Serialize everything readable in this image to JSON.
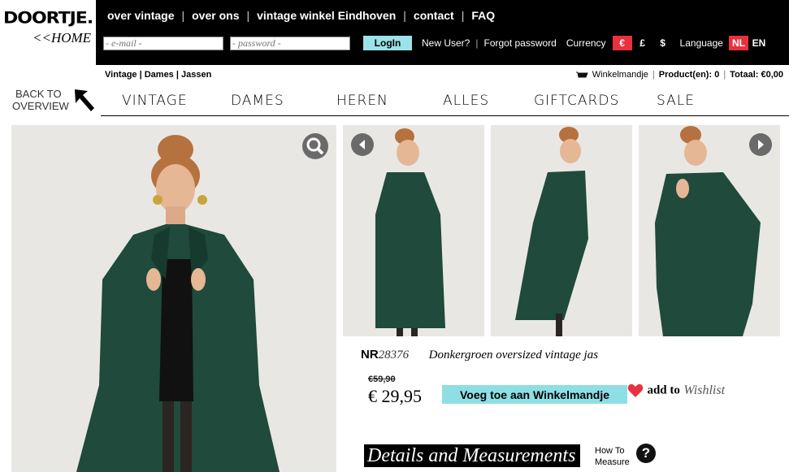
{
  "logo": {
    "brand": "DOORTJE.",
    "home_link": "<<HOME"
  },
  "topnav": {
    "items": [
      "over vintage",
      "over ons",
      "vintage winkel Eindhoven",
      "contact",
      "FAQ"
    ]
  },
  "login": {
    "email_placeholder": "- e-mail -",
    "password_placeholder": "- password -",
    "login_label": "LogIn",
    "new_user": "New User?",
    "forgot_password": "Forgot password"
  },
  "currency": {
    "label": "Currency",
    "options": [
      "€",
      "£",
      "$"
    ],
    "selected": "€",
    "active_color": "#e8313f"
  },
  "language": {
    "label": "Language",
    "options": [
      "NL",
      "EN"
    ],
    "selected": "NL"
  },
  "breadcrumb": {
    "text": "Vintage | Dames | Jassen"
  },
  "cart": {
    "label": "Winkelmandje",
    "products": "Product(en): 0",
    "total": "Totaal: €0,00"
  },
  "back": {
    "line1": "BACK TO",
    "line2": "OVERVIEW"
  },
  "mainnav": {
    "items": [
      "VINTAGE",
      "DAMES",
      "HEREN",
      "ALLES",
      "GIFTCARDS",
      "SALE"
    ]
  },
  "product": {
    "nr_label": "NR",
    "nr_value": "28376",
    "name": "Donkergroen oversized vintage jas",
    "old_price": "€59,90",
    "price": "€ 29,95",
    "add_to_cart": "Voeg toe aan Winkelmandje",
    "wishlist_add": "add to",
    "wishlist_word": "Wishlist",
    "details_heading": "Details and Measurements",
    "how_to_line1": "How To",
    "how_to_line2": "Measure",
    "help_symbol": "?"
  },
  "icons": {
    "zoom": "magnifier-icon",
    "prev": "arrow-left-icon",
    "next": "arrow-right-icon",
    "heart": "heart-icon",
    "cart": "shopping-cart-icon",
    "back": "arrow-up-left-icon"
  },
  "colors": {
    "coat_green": "#1f4a3c",
    "accent_cyan": "#8edfe3",
    "heart_red": "#e8313f"
  }
}
